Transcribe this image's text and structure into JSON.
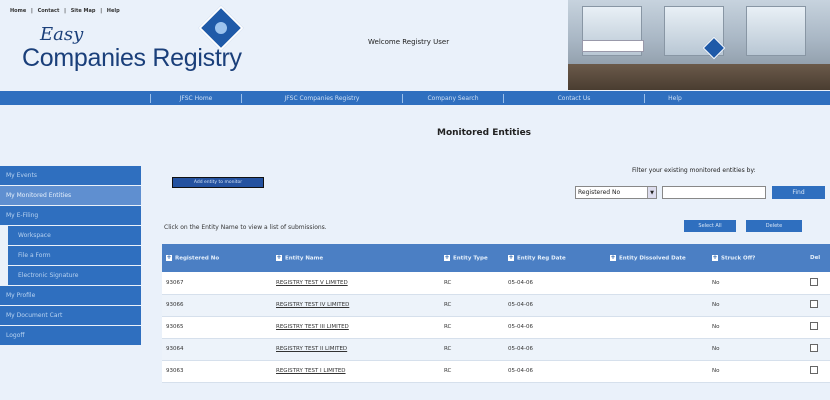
{
  "top_links": [
    "Home",
    "Contact",
    "Site Map",
    "Help"
  ],
  "top_link_sep": "|",
  "logo": {
    "line1": "Easy",
    "line2": "Companies Registry"
  },
  "welcome_text": "Welcome Registry User",
  "nav": [
    "JFSC Home",
    "JFSC Companies Registry",
    "Company Search",
    "Contact Us",
    "Help"
  ],
  "page_title": "Monitored Entities",
  "sidebar": [
    {
      "label": "My Events",
      "sub": false,
      "active": false
    },
    {
      "label": "My Monitored Entities",
      "sub": false,
      "active": true
    },
    {
      "label": "My E-Filing",
      "sub": false,
      "active": false
    },
    {
      "label": "Workspace",
      "sub": true,
      "active": false
    },
    {
      "label": "File a Form",
      "sub": true,
      "active": false
    },
    {
      "label": "Electronic Signature",
      "sub": true,
      "active": false
    },
    {
      "label": "My Profile",
      "sub": false,
      "active": false
    },
    {
      "label": "My Document Cart",
      "sub": false,
      "active": false
    },
    {
      "label": "Logoff",
      "sub": false,
      "active": false
    }
  ],
  "add_entity_label": "Add entity to monitor",
  "filter": {
    "label": "Filter your existing monitored entities by:",
    "selected": "Registered No",
    "input_value": "",
    "find_label": "Find"
  },
  "hint_text": "Click on the Entity Name to view a list of submissions.",
  "actions": {
    "select_all": "Select All",
    "delete": "Delete"
  },
  "table": {
    "columns": [
      "Registered No",
      "Entity Name",
      "Entity Type",
      "Entity Reg Date",
      "Entity Dissolved Date",
      "Struck Off?",
      "Del"
    ],
    "rows": [
      {
        "reg_no": "93067",
        "name": "REGISTRY TEST V LIMITED",
        "type": "RC",
        "reg_date": "05-04-06",
        "dissolved": "",
        "struck": "No"
      },
      {
        "reg_no": "93066",
        "name": "REGISTRY TEST IV LIMITED",
        "type": "RC",
        "reg_date": "05-04-06",
        "dissolved": "",
        "struck": "No"
      },
      {
        "reg_no": "93065",
        "name": "REGISTRY TEST III LIMITED",
        "type": "RC",
        "reg_date": "05-04-06",
        "dissolved": "",
        "struck": "No"
      },
      {
        "reg_no": "93064",
        "name": "REGISTRY TEST II LIMITED",
        "type": "RC",
        "reg_date": "05-04-06",
        "dissolved": "",
        "struck": "No"
      },
      {
        "reg_no": "93063",
        "name": "REGISTRY TEST I LIMITED",
        "type": "RC",
        "reg_date": "05-04-06",
        "dissolved": "",
        "struck": "No"
      }
    ]
  },
  "colors": {
    "nav_blue": "#2f6fbf",
    "header_blue": "#4b7fc4",
    "bg": "#eaf1fa"
  }
}
